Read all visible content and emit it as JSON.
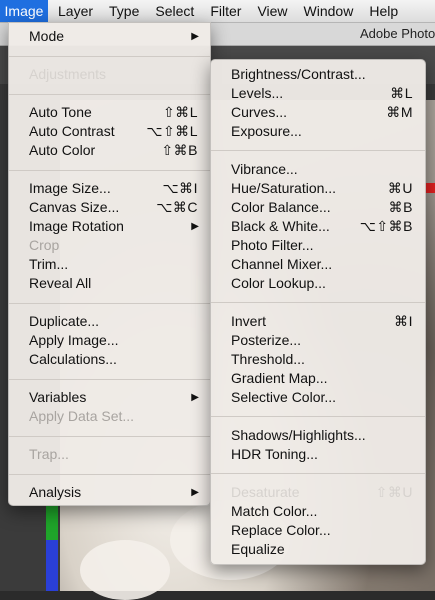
{
  "menubar": {
    "items": [
      "Image",
      "Layer",
      "Type",
      "Select",
      "Filter",
      "View",
      "Window",
      "Help"
    ]
  },
  "window": {
    "title": "Adobe Photo"
  },
  "image_menu": {
    "mode": "Mode",
    "adjustments": "Adjustments",
    "auto_tone": "Auto Tone",
    "auto_tone_sc": "⇧⌘L",
    "auto_contrast": "Auto Contrast",
    "auto_contrast_sc": "⌥⇧⌘L",
    "auto_color": "Auto Color",
    "auto_color_sc": "⇧⌘B",
    "image_size": "Image Size...",
    "image_size_sc": "⌥⌘I",
    "canvas_size": "Canvas Size...",
    "canvas_size_sc": "⌥⌘C",
    "image_rotation": "Image Rotation",
    "crop": "Crop",
    "trim": "Trim...",
    "reveal_all": "Reveal All",
    "duplicate": "Duplicate...",
    "apply_image": "Apply Image...",
    "calculations": "Calculations...",
    "variables": "Variables",
    "apply_data_set": "Apply Data Set...",
    "trap": "Trap...",
    "analysis": "Analysis"
  },
  "adjustments_menu": {
    "brightness_contrast": "Brightness/Contrast...",
    "levels": "Levels...",
    "levels_sc": "⌘L",
    "curves": "Curves...",
    "curves_sc": "⌘M",
    "exposure": "Exposure...",
    "vibrance": "Vibrance...",
    "hue_saturation": "Hue/Saturation...",
    "hue_saturation_sc": "⌘U",
    "color_balance": "Color Balance...",
    "color_balance_sc": "⌘B",
    "black_white": "Black & White...",
    "black_white_sc": "⌥⇧⌘B",
    "photo_filter": "Photo Filter...",
    "channel_mixer": "Channel Mixer...",
    "color_lookup": "Color Lookup...",
    "invert": "Invert",
    "invert_sc": "⌘I",
    "posterize": "Posterize...",
    "threshold": "Threshold...",
    "gradient_map": "Gradient Map...",
    "selective_color": "Selective Color...",
    "shadows_highlights": "Shadows/Highlights...",
    "hdr_toning": "HDR Toning...",
    "desaturate": "Desaturate",
    "desaturate_sc": "⇧⌘U",
    "match_color": "Match Color...",
    "replace_color": "Replace Color...",
    "equalize": "Equalize"
  },
  "colors": {
    "menubar_active": "#1f6fe0",
    "red_marker": "#e02020",
    "green_channel": "#1fa52a",
    "blue_channel": "#2a3fd8"
  }
}
